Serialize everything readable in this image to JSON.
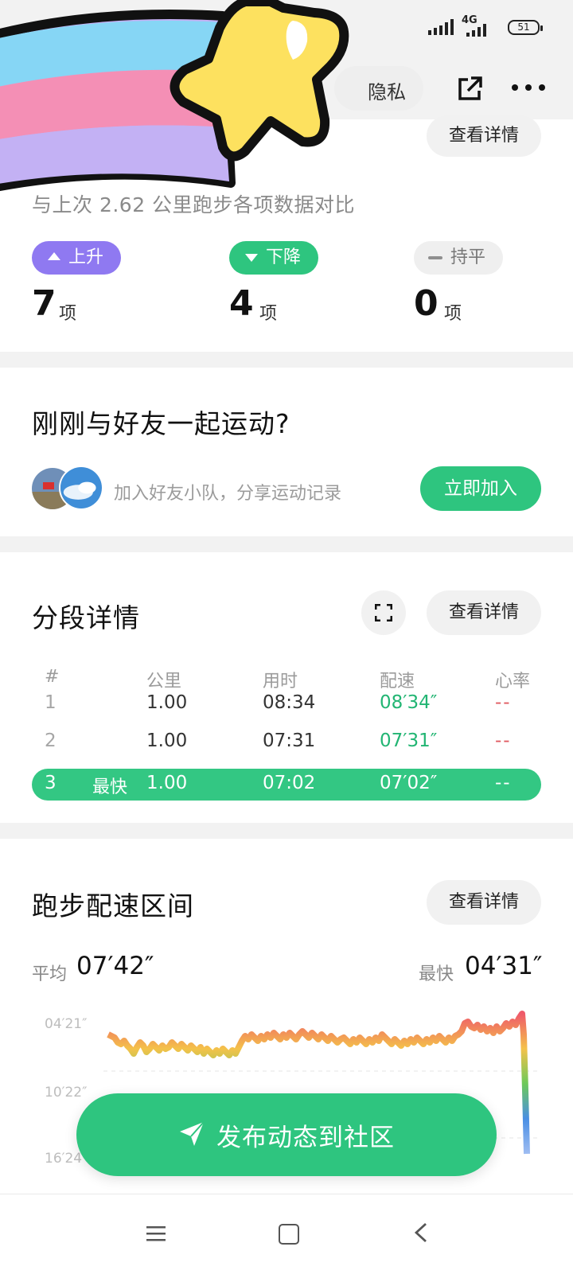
{
  "status_bar": {
    "network": "4G",
    "battery": "51"
  },
  "header": {
    "privacy_label": "隐私"
  },
  "comparison": {
    "view_details": "查看详情",
    "note": "与上次 2.62 公里跑步各项数据对比",
    "up": {
      "label": "上升",
      "count": "7",
      "unit": "项"
    },
    "down": {
      "label": "下降",
      "count": "4",
      "unit": "项"
    },
    "flat": {
      "label": "持平",
      "count": "0",
      "unit": "项"
    }
  },
  "friends": {
    "title": "刚刚与好友一起运动?",
    "invite_text": "加入好友小队，分享运动记录",
    "join_button": "立即加入"
  },
  "splits": {
    "title": "分段详情",
    "view_details": "查看详情",
    "headers": [
      "#",
      "公里",
      "用时",
      "配速",
      "心率"
    ],
    "rows": [
      {
        "index": "1",
        "km": "1.00",
        "time": "08:34",
        "pace": "08′34″",
        "hr": "--"
      },
      {
        "index": "2",
        "km": "1.00",
        "time": "07:31",
        "pace": "07′31″",
        "hr": "--"
      }
    ],
    "fastest": {
      "index": "3",
      "label": "最快",
      "km": "1.00",
      "time": "07:02",
      "pace": "07′02″",
      "hr": "--"
    }
  },
  "pace_zone": {
    "title": "跑步配速区间",
    "view_details": "查看详情",
    "avg_label": "平均",
    "avg_value": "07′42″",
    "fastest_label": "最快",
    "fastest_value": "04′31″",
    "y_ticks": [
      "04′21″",
      "10′22″",
      "16′24″"
    ]
  },
  "post_button": {
    "label": "发布动态到社区"
  },
  "colors": {
    "accent_green": "#2ec57f",
    "up_purple": "#8f79f1",
    "hr_red": "#e05a60"
  }
}
